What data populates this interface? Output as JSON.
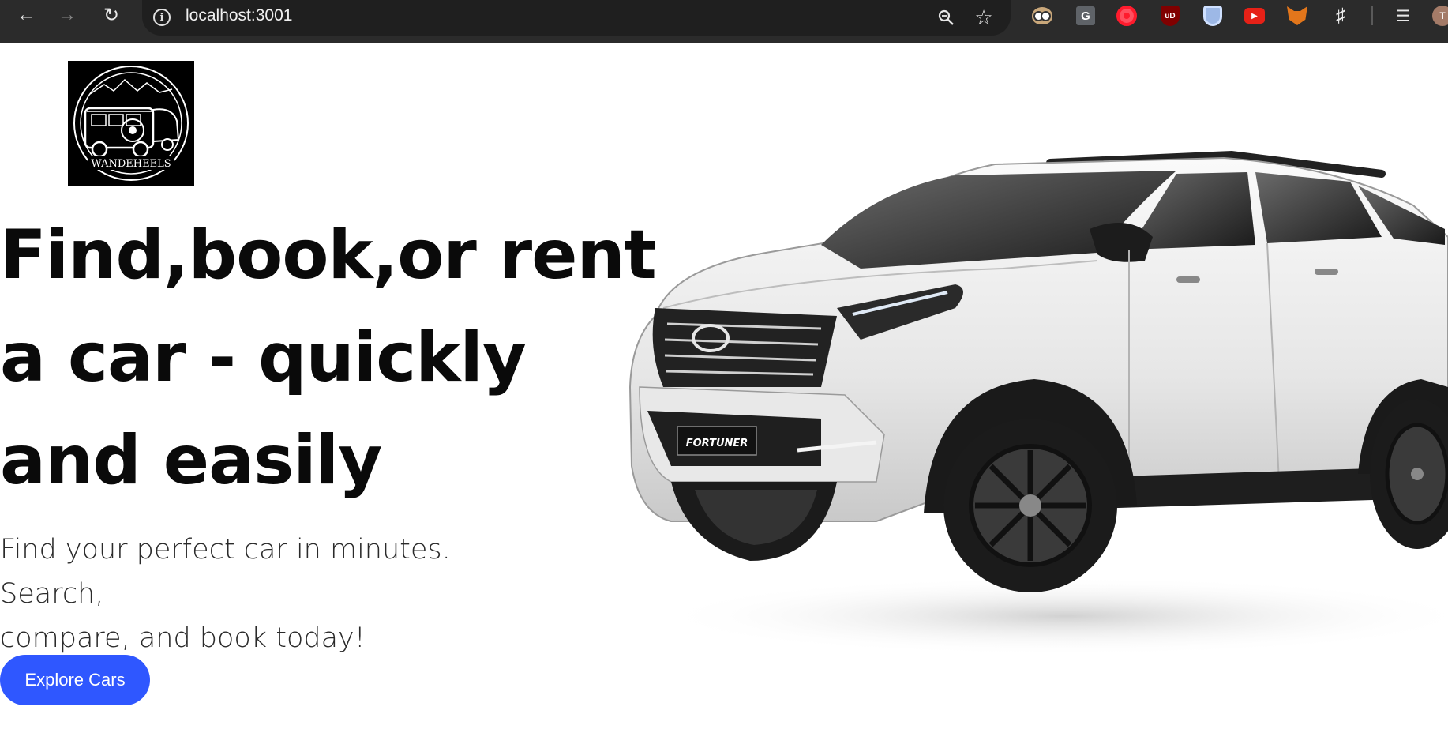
{
  "browser": {
    "url": "localhost:3001",
    "icons": {
      "back": "arrow-left-icon",
      "forward": "arrow-right-icon",
      "reload": "reload-icon",
      "site_info": "info-icon",
      "zoom": "zoom-icon",
      "bookmark": "star-icon"
    },
    "extensions": {
      "g_label": "G",
      "ublock_label": "uD",
      "avatar_initial": "T"
    }
  },
  "logo": {
    "text": "WANDEHEELS"
  },
  "hero": {
    "headline_lines": [
      "Find,book,or rent",
      "a car - quickly",
      "and easily"
    ],
    "subtitle_lines": [
      "Find your perfect car in minutes. Search,",
      "compare, and book today!"
    ],
    "cta_label": "Explore Cars",
    "car_plate": "FORTUNER"
  },
  "colors": {
    "chrome_bg": "#2b2b2b",
    "omnibox_bg": "#1f1f1f",
    "accent": "#2f57ff",
    "heading": "#0a0a0a"
  }
}
